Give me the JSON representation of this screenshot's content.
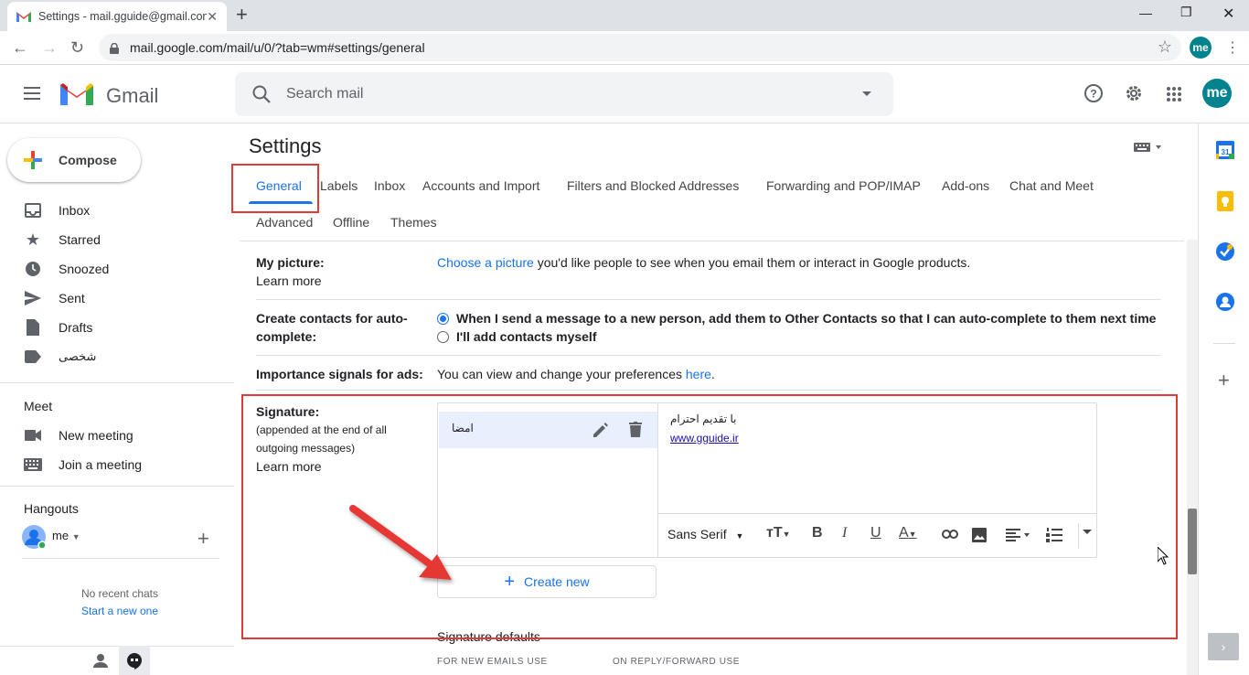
{
  "browser": {
    "tab_title": "Settings - mail.gguide@gmail.com",
    "url": "mail.google.com/mail/u/0/?tab=wm#settings/general",
    "profile_initials": "me"
  },
  "header": {
    "app_name": "Gmail",
    "search_placeholder": "Search mail",
    "avatar_initials": "me"
  },
  "sidebar": {
    "compose_label": "Compose",
    "items": [
      {
        "label": "Inbox"
      },
      {
        "label": "Starred"
      },
      {
        "label": "Snoozed"
      },
      {
        "label": "Sent"
      },
      {
        "label": "Drafts"
      },
      {
        "label": "شخصی"
      }
    ],
    "meet": {
      "title": "Meet",
      "new_meeting": "New meeting",
      "join_meeting": "Join a meeting"
    },
    "hangouts": {
      "title": "Hangouts",
      "user": "me",
      "no_chats": "No recent chats",
      "start_new": "Start a new one"
    }
  },
  "settings": {
    "title": "Settings",
    "tabs": [
      {
        "label": "General",
        "active": true
      },
      {
        "label": "Labels"
      },
      {
        "label": "Inbox"
      },
      {
        "label": "Accounts and Import"
      },
      {
        "label": "Filters and Blocked Addresses"
      },
      {
        "label": "Forwarding and POP/IMAP"
      },
      {
        "label": "Add-ons"
      },
      {
        "label": "Chat and Meet"
      },
      {
        "label": "Advanced"
      },
      {
        "label": "Offline"
      },
      {
        "label": "Themes"
      }
    ],
    "my_picture": {
      "label": "My picture:",
      "learn_more": "Learn more",
      "link": "Choose a picture",
      "text": " you'd like people to see when you email them or interact in Google products."
    },
    "contacts": {
      "label_line1": "Create contacts for auto-",
      "label_line2": "complete:",
      "option1": "When I send a message to a new person, add them to Other Contacts so that I can auto-complete to them next time",
      "option2": "I'll add contacts myself"
    },
    "ads": {
      "label": "Importance signals for ads:",
      "text": "You can view and change your preferences ",
      "link": "here",
      "end": "."
    },
    "signature": {
      "label": "Signature:",
      "sub1": "(appended at the end of all",
      "sub2": "outgoing messages)",
      "learn_more": "Learn more",
      "item_name": "امضا",
      "editor_line1": "با تقدیم احترام",
      "editor_link": "www.gguide.ir",
      "font": "Sans Serif",
      "create_new": "Create new",
      "defaults_title": "Signature defaults",
      "new_emails": "FOR NEW EMAILS USE",
      "reply_forward": "ON REPLY/FORWARD USE"
    }
  },
  "colors": {
    "accent": "#1a73e8",
    "highlight_red": "#e53935",
    "arrow_red": "#e53935"
  }
}
